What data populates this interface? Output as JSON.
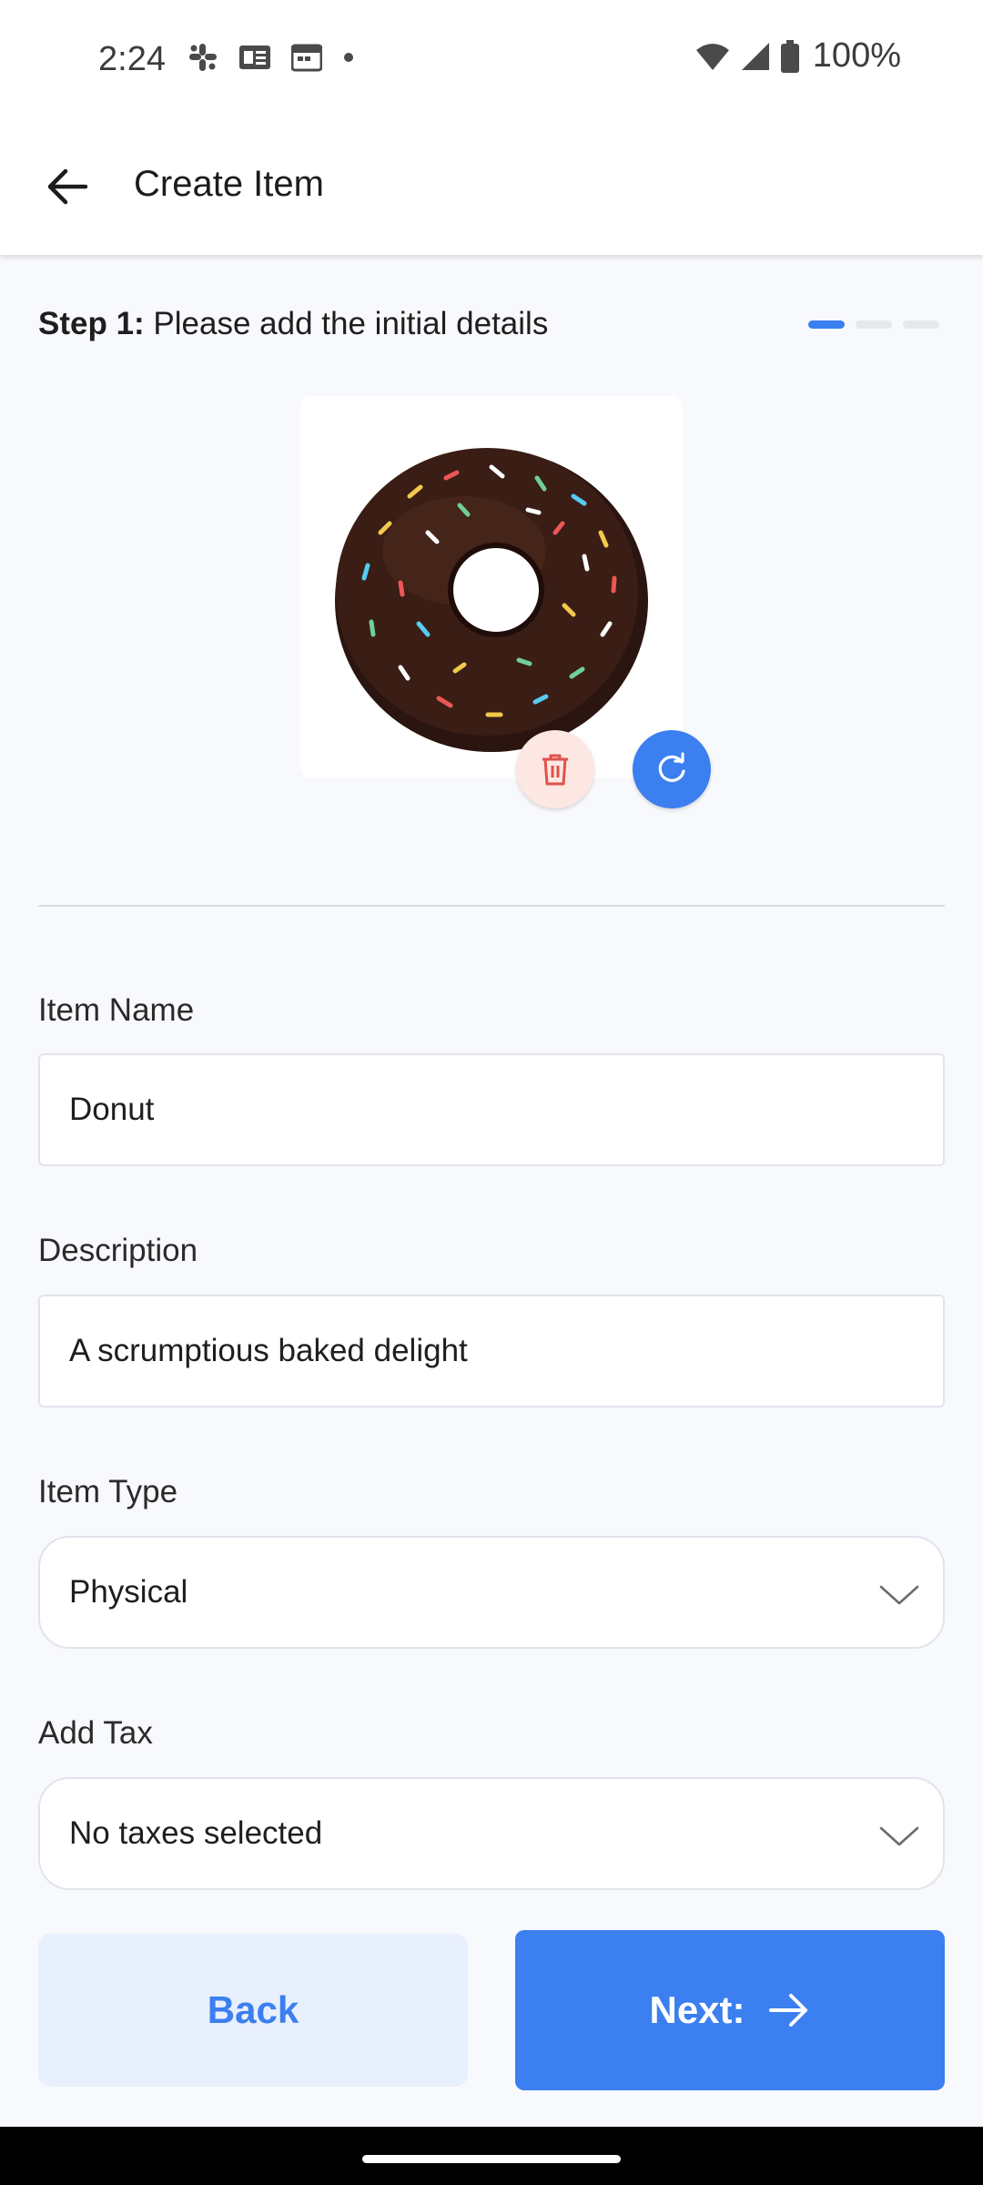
{
  "status_bar": {
    "time": "2:24",
    "battery": "100%",
    "icons_left": [
      "slack-icon",
      "news-icon",
      "calendar-icon",
      "dot-icon"
    ],
    "icons_right": [
      "wifi-icon",
      "signal-icon",
      "battery-icon"
    ]
  },
  "app_bar": {
    "title": "Create Item",
    "back_icon": "arrow-left-icon"
  },
  "step": {
    "label": "Step 1:",
    "text": " Please add the initial details",
    "current": 1,
    "total": 3
  },
  "image": {
    "subject": "chocolate donut with sprinkles",
    "delete_icon": "trash-icon",
    "replace_icon": "refresh-icon"
  },
  "form": {
    "item_name": {
      "label": "Item Name",
      "value": "Donut"
    },
    "description": {
      "label": "Description",
      "value": "A scrumptious baked delight"
    },
    "item_type": {
      "label": "Item Type",
      "value": "Physical"
    },
    "add_tax": {
      "label": "Add Tax",
      "value": "No taxes selected"
    }
  },
  "buttons": {
    "back": "Back",
    "next": "Next:"
  },
  "colors": {
    "accent": "#3b7ff0",
    "back_button_bg": "#e8effd",
    "delete_button_bg": "#fde7e2",
    "background": "#f8f9fc"
  }
}
